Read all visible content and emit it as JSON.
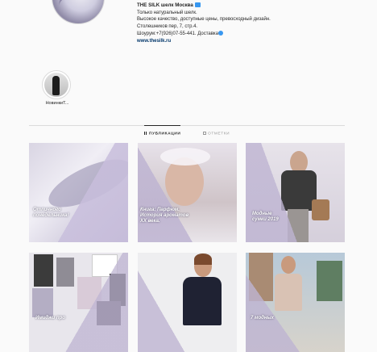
{
  "profile": {
    "name": "THE SILK шелк Москва",
    "bio_lines": [
      "Только натуральный шелк.",
      "Высокое качество, доступные цены, превосходный дизайн.",
      "Столешников пер, 7, стр.4.",
      "Шоурум:+7(926)07-55-441. Доставка"
    ],
    "website": "www.thesilk.ru"
  },
  "highlight": {
    "label": "НовинкиT..."
  },
  "tabs": {
    "posts": "ПУБЛИКАЦИИ",
    "tagged": "ОТМЕТКИ"
  },
  "posts": [
    {
      "caption": "Отличного\nпонедельника!"
    },
    {
      "caption": "Книга: Парфюм.\nИстория ароматов\nXX века."
    },
    {
      "caption": "Модные\nсумки 2019"
    },
    {
      "caption": "Имиджи про"
    },
    {
      "caption": ""
    },
    {
      "caption": "7 модных"
    }
  ],
  "colors": {
    "accent_purple": "#b8aecb",
    "link_blue": "#003569",
    "verified_blue": "#3897f0"
  }
}
